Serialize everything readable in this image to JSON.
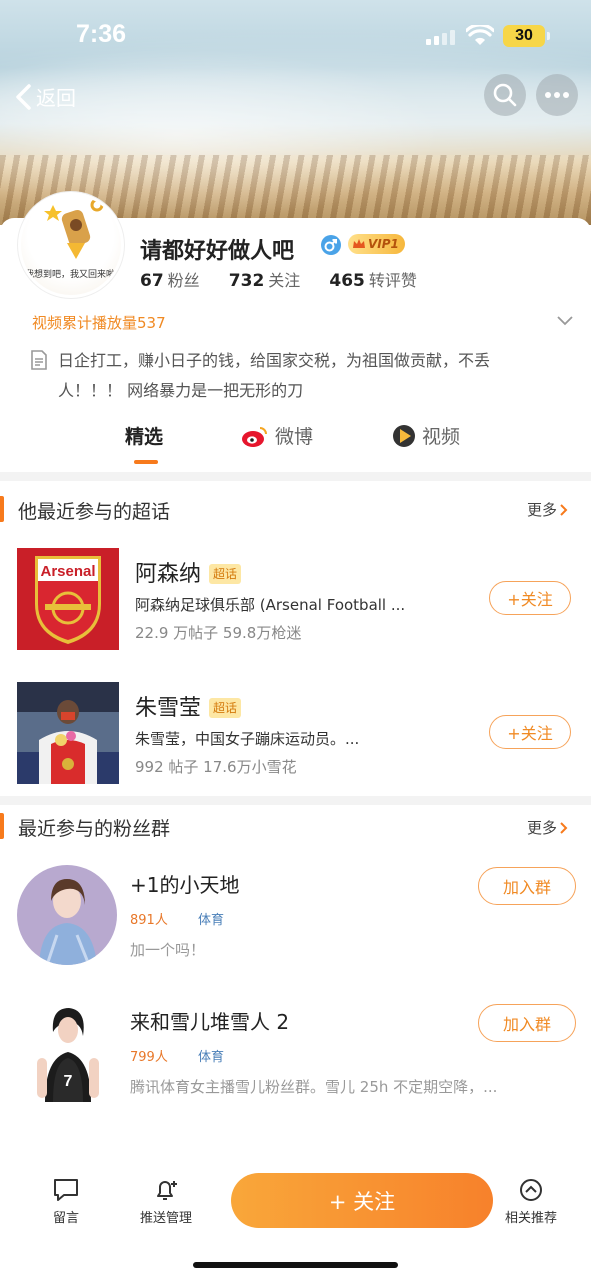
{
  "status_bar": {
    "time": "7:36",
    "battery": "30"
  },
  "nav": {
    "back_label": "返回"
  },
  "profile": {
    "name": "请都好好做人吧",
    "vip_label": "VIP1",
    "avatar_caption": "我想到吧，我又回来啦",
    "stats": [
      {
        "value": "67",
        "label": "粉丝"
      },
      {
        "value": "732",
        "label": "关注"
      },
      {
        "value": "465",
        "label": "转评赞"
      }
    ],
    "video_play_count": "视频累计播放量537",
    "bio_line1": "日企打工，赚小日子的钱，给国家交税，为祖国做贡献，不丢",
    "bio_line2": "人！！！ 网络暴力是一把无形的刀"
  },
  "tabs": [
    {
      "label": "精选",
      "active": true
    },
    {
      "label": "微博",
      "active": false
    },
    {
      "label": "视频",
      "active": false
    }
  ],
  "supertopics": {
    "title": "他最近参与的超话",
    "more": "更多",
    "badge": "超话",
    "follow_label": "+关注",
    "items": [
      {
        "name": "阿森纳",
        "thumb_text": "Arsenal",
        "desc": "阿森纳足球俱乐部 (Arsenal Football ...",
        "meta": "22.9 万帖子 59.8万枪迷"
      },
      {
        "name": "朱雪莹",
        "desc": "朱雪莹，中国女子蹦床运动员。...",
        "meta": "992 帖子 17.6万小雪花"
      }
    ]
  },
  "fan_groups": {
    "title": "最近参与的粉丝群",
    "more": "更多",
    "join_label": "加入群",
    "items": [
      {
        "name": "+1的小天地",
        "count": "891人",
        "category": "体育",
        "desc": "加一个吗！"
      },
      {
        "name": "来和雪儿堆雪人 2",
        "count": "799人",
        "category": "体育",
        "desc": "腾讯体育女主播雪儿粉丝群。雪儿 25h 不定期空降，..."
      }
    ]
  },
  "bottom_bar": {
    "message": "留言",
    "push": "推送管理",
    "follow": "+ 关注",
    "related": "相关推荐"
  },
  "colors": {
    "accent": "#f77a1c",
    "link_blue": "#4a7fb8"
  }
}
